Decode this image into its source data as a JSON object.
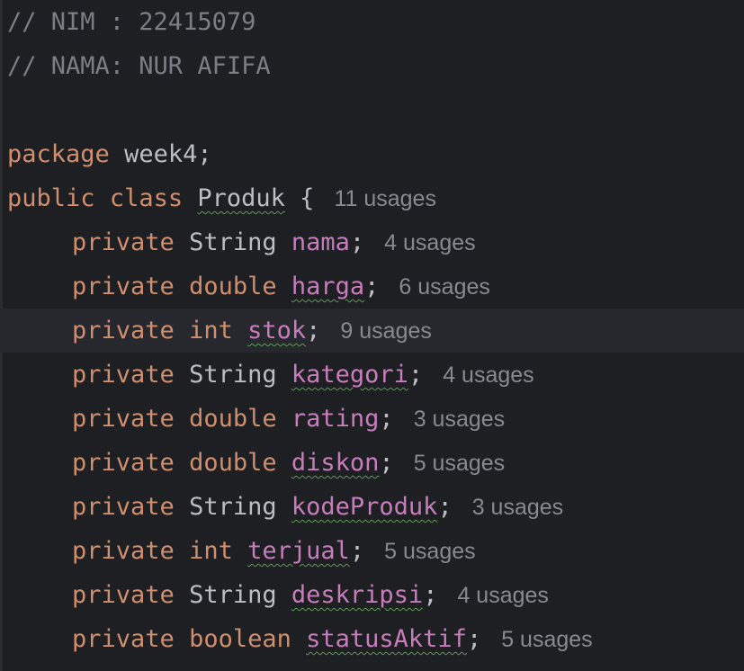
{
  "comments": [
    "// NIM : 22415079",
    "// NAMA: NUR AFIFA"
  ],
  "package_line": {
    "keyword": "package",
    "name": "week4",
    "terminator": ";"
  },
  "class_decl": {
    "modifier": "public",
    "keyword": "class",
    "name": "Produk",
    "brace": "{",
    "usages": "11 usages"
  },
  "fields": [
    {
      "modifier": "private",
      "type": "String",
      "name": "nama",
      "semicolon": ";",
      "usages": "4 usages"
    },
    {
      "modifier": "private",
      "type": "double",
      "name": "harga",
      "semicolon": ";",
      "usages": "6 usages"
    },
    {
      "modifier": "private",
      "type": "int",
      "name": "stok",
      "semicolon": ";",
      "usages": "9 usages"
    },
    {
      "modifier": "private",
      "type": "String",
      "name": "kategori",
      "semicolon": ";",
      "usages": "4 usages"
    },
    {
      "modifier": "private",
      "type": "double",
      "name": "rating",
      "semicolon": ";",
      "usages": "3 usages"
    },
    {
      "modifier": "private",
      "type": "double",
      "name": "diskon",
      "semicolon": ";",
      "usages": "5 usages"
    },
    {
      "modifier": "private",
      "type": "String",
      "name": "kodeProduk",
      "semicolon": ";",
      "usages": "3 usages"
    },
    {
      "modifier": "private",
      "type": "int",
      "name": "terjual",
      "semicolon": ";",
      "usages": "5 usages"
    },
    {
      "modifier": "private",
      "type": "String",
      "name": "deskripsi",
      "semicolon": ";",
      "usages": "4 usages"
    },
    {
      "modifier": "private",
      "type": "boolean",
      "name": "statusAktif",
      "semicolon": ";",
      "usages": "5 usages"
    }
  ],
  "colors": {
    "background": "#1e1f22",
    "current_line": "#26282e",
    "comment": "#7a7e85",
    "keyword": "#cf8e6d",
    "text": "#bcbec4",
    "field": "#c77dbb",
    "inlay_hint": "#868a91",
    "squiggle": "#5f9a56"
  }
}
